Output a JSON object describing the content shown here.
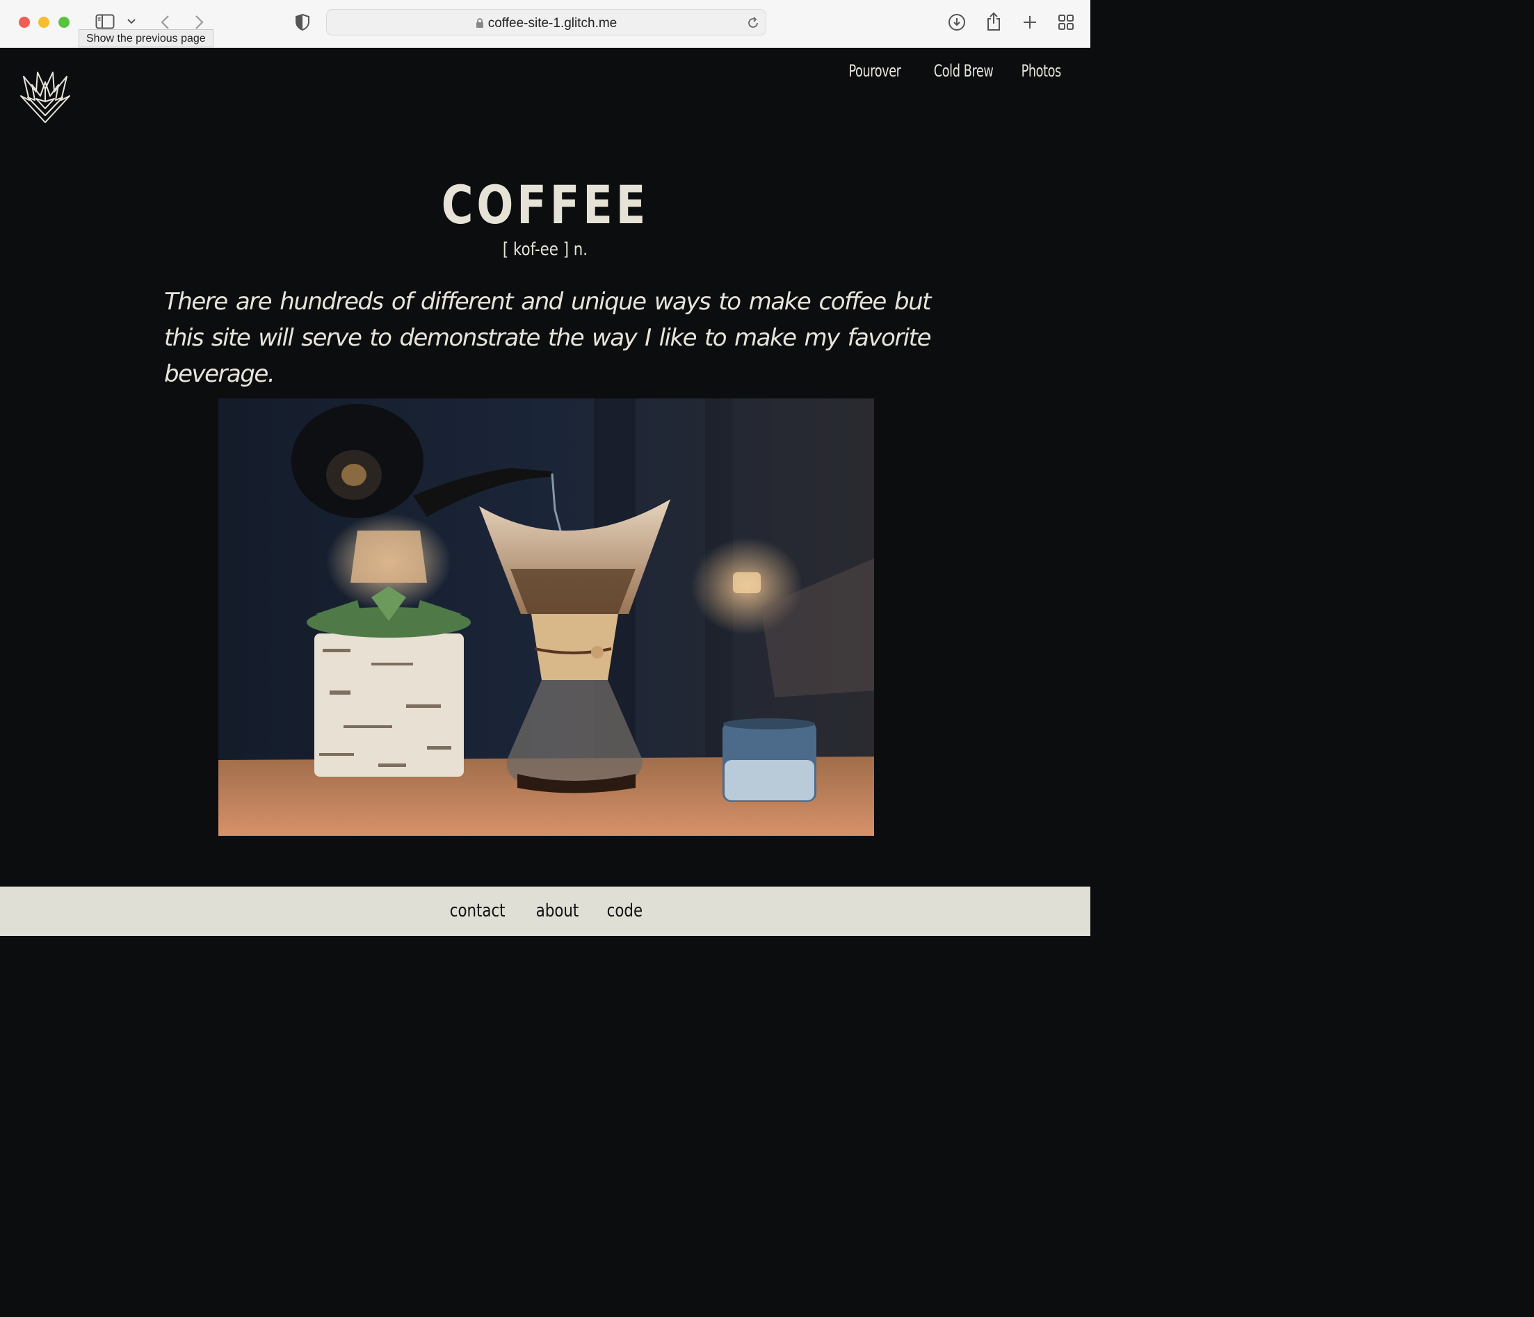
{
  "browser": {
    "url": "coffee-site-1.glitch.me",
    "tooltip": "Show the previous page"
  },
  "nav": {
    "items": [
      {
        "label": "Pourover"
      },
      {
        "label": "Cold Brew"
      },
      {
        "label": "Photos"
      }
    ]
  },
  "hero": {
    "title": "COFFEE",
    "pronunciation": "[ kof-ee ] n.",
    "intro": "There are hundreds of different and unique ways to make coffee but this site will serve to demonstrate the way I like to make my favorite beverage."
  },
  "footer": {
    "links": [
      {
        "label": "contact"
      },
      {
        "label": "about"
      },
      {
        "label": "code"
      }
    ]
  },
  "colors": {
    "page_background": "#0b0d0e",
    "text": "#e6e2d6",
    "footer_background": "#e0dfd5"
  }
}
